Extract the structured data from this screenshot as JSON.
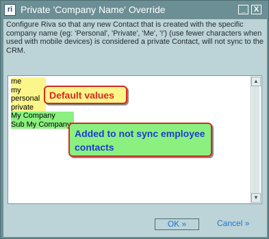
{
  "window": {
    "icon_text": "ri",
    "title": "Private 'Company Name' Override",
    "minimize_glyph": "_",
    "close_glyph": "X"
  },
  "description": "Configure Riva so that any new Contact that is created with the specific company name (eg: 'Personal', 'Private', 'Me', '!') (use fewer characters when used with mobile devices) is considered a private Contact, will not sync to the CRM.",
  "entries": {
    "default": [
      "me",
      "my",
      "personal",
      "private"
    ],
    "added": [
      "My Company",
      "Sub My Company"
    ]
  },
  "callouts": {
    "default_values": "Default values",
    "added_line1": "Added to not sync employee",
    "added_line2": "contacts"
  },
  "buttons": {
    "ok": "OK »",
    "cancel": "Cancel »"
  },
  "scrollbar": {
    "up_glyph": "▲",
    "down_glyph": "▼"
  },
  "colors": {
    "title_bar": "#6b8f94",
    "client_bg": "#bcd3d7",
    "highlight_yellow": "#fbf58a",
    "highlight_green": "#8bf07f",
    "callout_border": "#d42a1f",
    "link_blue": "#1c77d1"
  }
}
